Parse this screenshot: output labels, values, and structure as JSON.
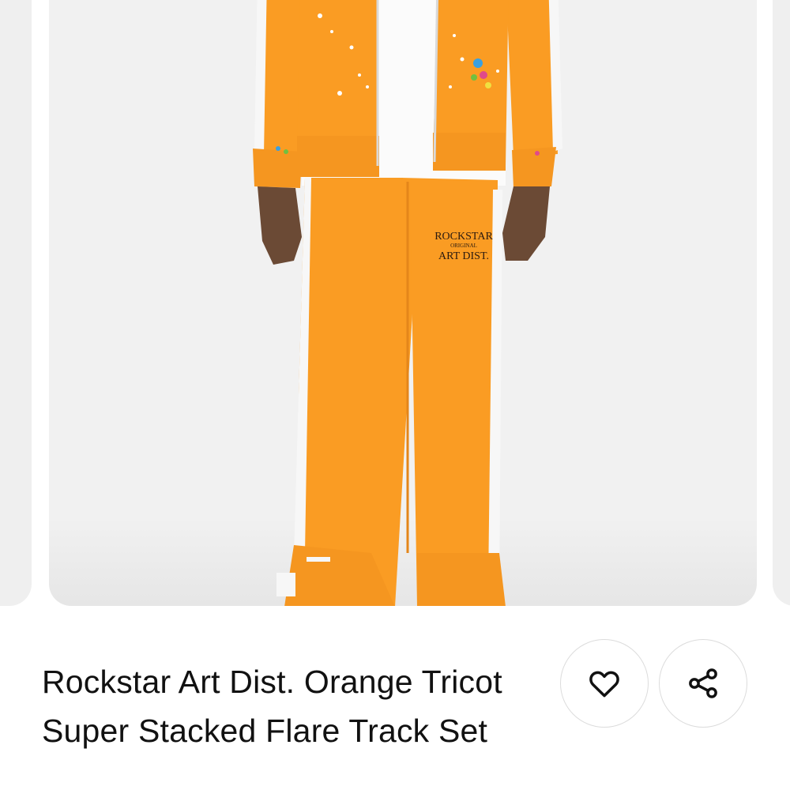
{
  "product_image": {
    "print_line1": "ROCKSTAR",
    "print_line2": "ORIGINAL",
    "print_line3": "ART DIST.",
    "colors": {
      "orange": "#FA9C23",
      "orange_shade": "#E4861A",
      "white_stripe": "#F7F7F7",
      "background": "#F1F1F1"
    }
  },
  "product": {
    "title": "Rockstar Art Dist. Orange Tricot Super Stacked Flare Track Set"
  },
  "actions": {
    "like_icon": "heart-icon",
    "share_icon": "share-icon"
  }
}
